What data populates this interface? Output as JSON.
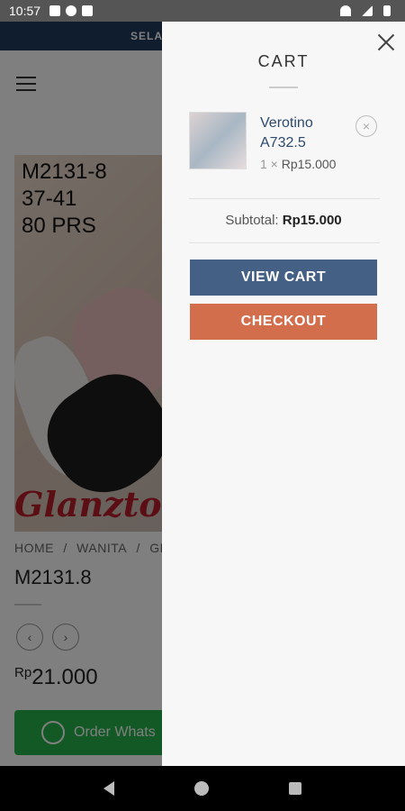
{
  "status": {
    "time": "10:57"
  },
  "page": {
    "promo_text": "SELA",
    "image": {
      "code_line1": "M2131-8",
      "code_line2": "37-41",
      "code_line3": "80 PRS",
      "brand": "Glanzton"
    },
    "breadcrumb": [
      "HOME",
      "/",
      "WANITA",
      "/",
      "GLA"
    ],
    "product_title": "M2131.8",
    "price_currency": "Rp",
    "price_amount": "21.000",
    "whatsapp_label": "Order Whats"
  },
  "cart": {
    "title": "CART",
    "items": [
      {
        "name": "Verotino A732.5",
        "qty": "1 ×",
        "price": "Rp15.000"
      }
    ],
    "subtotal_label": "Subtotal:",
    "subtotal_value": "Rp15.000",
    "view_cart_label": "VIEW CART",
    "checkout_label": "CHECKOUT"
  },
  "colors": {
    "view_cart": "#446084",
    "checkout": "#d26e4b",
    "whatsapp": "#25b34a",
    "item_name": "#2d4a6e"
  },
  "icons": [
    "close-icon",
    "remove-icon",
    "hamburger-icon",
    "whatsapp-icon",
    "back-icon",
    "home-icon",
    "recents-icon"
  ]
}
